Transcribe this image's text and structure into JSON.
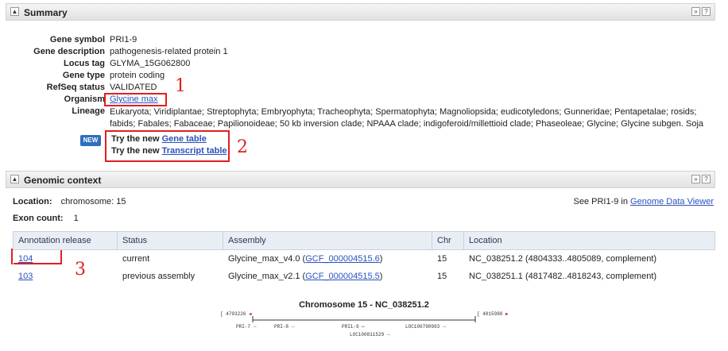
{
  "summary": {
    "title": "Summary",
    "toggle": "▲",
    "btn_a": "»",
    "btn_b": "?",
    "rows": [
      {
        "label": "Gene symbol",
        "value": "PRI1-9"
      },
      {
        "label": "Gene description",
        "value": "pathogenesis-related protein 1"
      },
      {
        "label": "Locus tag",
        "value": "GLYMA_15G062800"
      },
      {
        "label": "Gene type",
        "value": "protein coding"
      },
      {
        "label": "RefSeq status",
        "value": "VALIDATED"
      }
    ],
    "organism_label": "Organism",
    "organism_value": "Glycine max",
    "lineage_label": "Lineage",
    "lineage_value": "Eukaryota; Viridiplantae; Streptophyta; Embryophyta; Tracheophyta; Spermatophyta; Magnoliopsida; eudicotyledons; Gunneridae; Pentapetalae; rosids; fabids; Fabales; Fabaceae; Papilionoideae; 50 kb inversion clade; NPAAA clade; indigoferoid/millettioid clade; Phaseoleae; Glycine; Glycine subgen. Soja",
    "new_badge": "NEW",
    "try1_prefix": "Try the new ",
    "try1_link": "Gene table",
    "try2_prefix": "Try the new ",
    "try2_link": "Transcript table"
  },
  "annotations": {
    "a1": "1",
    "a2": "2",
    "a3": "3"
  },
  "genomic": {
    "title": "Genomic context",
    "location_label": "Location:",
    "location_value": "chromosome: 15",
    "exon_label": "Exon count:",
    "exon_value": "1",
    "see_prefix": "See PRI1-9 in ",
    "see_link": "Genome Data Viewer",
    "table": {
      "headers": [
        "Annotation release",
        "Status",
        "Assembly",
        "Chr",
        "Location"
      ],
      "rows": [
        {
          "release": "104",
          "status": "current",
          "assembly": "Glycine_max_v4.0 (",
          "acc": "GCF_000004515.6",
          "close": ")",
          "chr": "15",
          "location": "NC_038251.2 (4804333..4805089, complement)"
        },
        {
          "release": "103",
          "status": "previous assembly",
          "assembly": "Glycine_max_v2.1 (",
          "acc": "GCF_000004515.5",
          "close": ")",
          "chr": "15",
          "location": "NC_038251.1 (4817482..4818243, complement)"
        }
      ]
    }
  },
  "chromosome": {
    "title": "Chromosome 15 - NC_038251.2",
    "left_coord": "4793226",
    "right_coord": "4815988",
    "genes": [
      {
        "name": "PRI-7"
      },
      {
        "name": "PRI-8"
      },
      {
        "name": "PRI1-9"
      },
      {
        "name": "LOC100790993"
      },
      {
        "name": "LOC100811529"
      }
    ]
  },
  "colors": {
    "accent": "#2a52be",
    "annotation": "#e02020",
    "highlight_gene": "#c0392b"
  }
}
